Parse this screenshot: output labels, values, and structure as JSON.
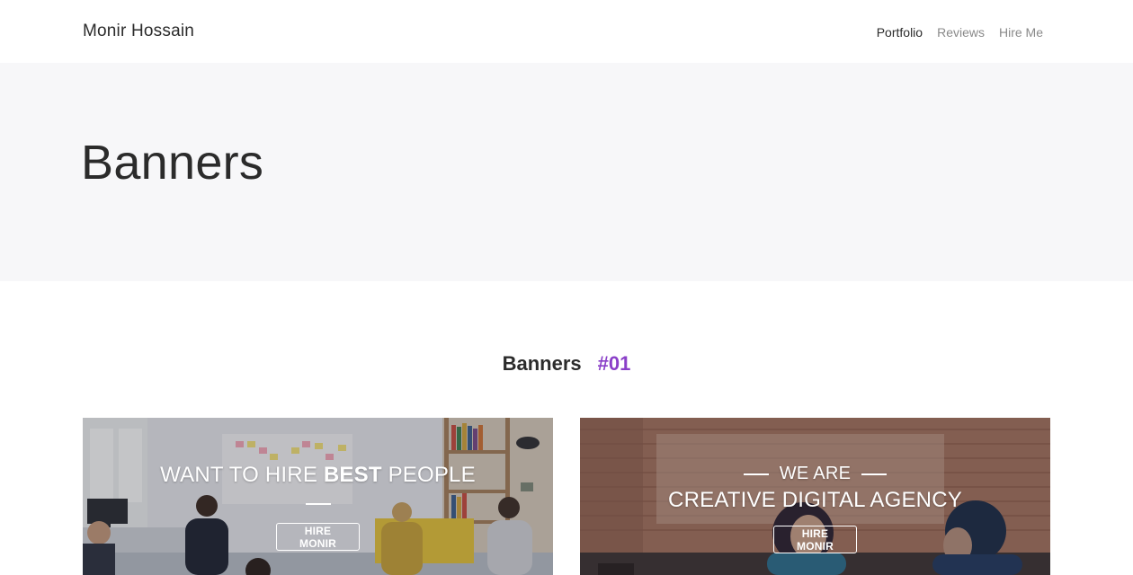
{
  "navbar": {
    "brand": "Monir Hossain",
    "links": [
      {
        "label": "Portfolio",
        "active": true
      },
      {
        "label": "Reviews",
        "active": false
      },
      {
        "label": "Hire Me",
        "active": false
      }
    ]
  },
  "hero": {
    "title": "Banners"
  },
  "section": {
    "title": "Banners",
    "number": "#01"
  },
  "banners": [
    {
      "headline_prefix": "WANT TO HIRE ",
      "headline_bold": "BEST",
      "headline_suffix": " PEOPLE",
      "button_label": "HIRE MONIR"
    },
    {
      "kicker": "WE ARE",
      "headline": "CREATIVE DIGITAL AGENCY",
      "button_label": "HIRE MONIR"
    }
  ],
  "colors": {
    "accent": "#8a3fc8",
    "hero_background": "#f7f7f9",
    "text": "#2b2b2b",
    "muted_nav": "#8a8a8a"
  }
}
